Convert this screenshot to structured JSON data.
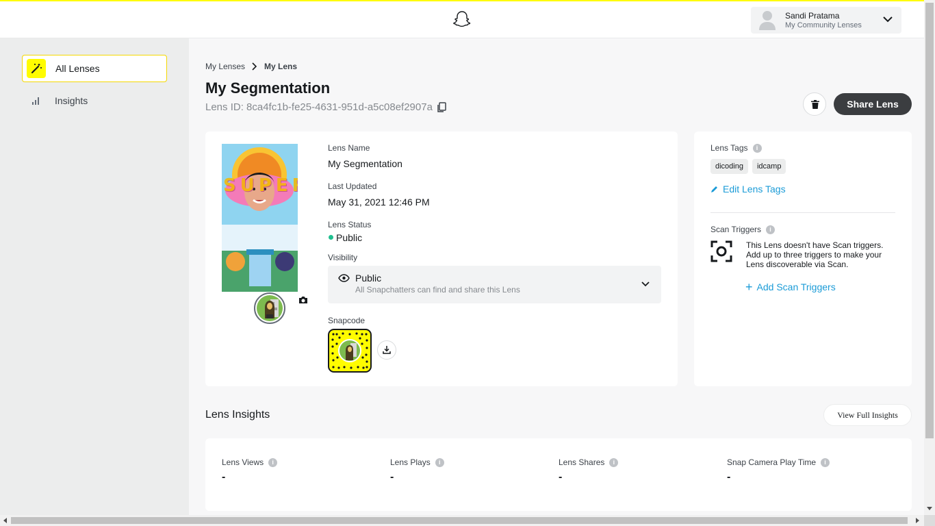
{
  "header": {
    "user_name": "Sandi Pratama",
    "user_sub": "My Community Lenses"
  },
  "sidebar": {
    "items": [
      {
        "label": "All Lenses",
        "active": true,
        "icon": "magic-wand-icon"
      },
      {
        "label": "Insights",
        "active": false,
        "icon": "bar-chart-icon"
      }
    ]
  },
  "breadcrumb": {
    "parent": "My Lenses",
    "current": "My Lens"
  },
  "lens": {
    "title": "My Segmentation",
    "id_text": "Lens ID: 8ca4fc1b-fe25-4631-951d-a5c08ef2907a",
    "share_label": "Share Lens",
    "name_label": "Lens Name",
    "name_value": "My Segmentation",
    "updated_label": "Last Updated",
    "updated_value": "May 31, 2021 12:46 PM",
    "status_label": "Lens Status",
    "status_value": "Public",
    "visibility_label": "Visibility",
    "visibility_value": "Public",
    "visibility_desc": "All Snapchatters can find and share this Lens",
    "snapcode_label": "Snapcode",
    "thumb_text": "SUPER"
  },
  "tags": {
    "label": "Lens Tags",
    "items": [
      "dicoding",
      "idcamp"
    ],
    "edit_label": "Edit Lens Tags"
  },
  "scan": {
    "label": "Scan Triggers",
    "desc": "This Lens doesn't have Scan triggers. Add up to three triggers to make your Lens discoverable via Scan.",
    "add_label": "Add Scan Triggers"
  },
  "insights": {
    "title": "Lens Insights",
    "view_full_label": "View Full Insights",
    "stats": [
      {
        "label": "Lens Views",
        "value": "-"
      },
      {
        "label": "Lens Plays",
        "value": "-"
      },
      {
        "label": "Lens Shares",
        "value": "-"
      },
      {
        "label": "Snap Camera Play Time",
        "value": "-"
      }
    ]
  },
  "colors": {
    "accent": "#fffc00",
    "status_green": "#1fbf8f",
    "link": "#1a9bd7"
  }
}
